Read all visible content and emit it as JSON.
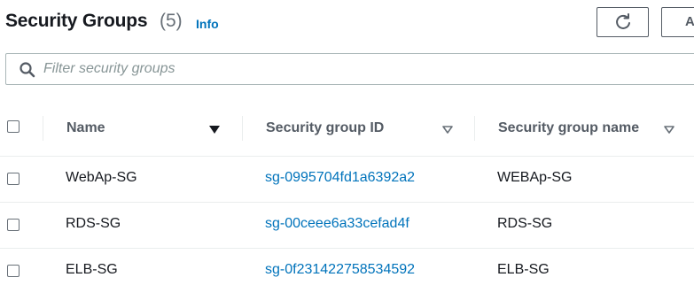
{
  "header": {
    "title": "Security Groups",
    "count": "(5)",
    "info_label": "Info",
    "actions_label": "A"
  },
  "search": {
    "placeholder": "Filter security groups",
    "value": ""
  },
  "table": {
    "columns": [
      {
        "label": "Name",
        "sort": "descending"
      },
      {
        "label": "Security group ID",
        "sort": "none"
      },
      {
        "label": "Security group name",
        "sort": "none"
      }
    ],
    "rows": [
      {
        "name": "WebAp-SG",
        "group_id": "sg-0995704fd1a6392a2",
        "group_name": "WEBAp-SG"
      },
      {
        "name": "RDS-SG",
        "group_id": "sg-00ceee6a33cefad4f",
        "group_name": "RDS-SG"
      },
      {
        "name": "ELB-SG",
        "group_id": "sg-0f231422758534592",
        "group_name": "ELB-SG"
      }
    ]
  },
  "colors": {
    "link": "#0073bb",
    "text": "#16191f",
    "muted": "#687078",
    "border": "#eaeded"
  },
  "icons": {
    "refresh": "refresh-icon",
    "search": "search-icon",
    "sort_active": "caret-down-filled-icon",
    "sort_inactive": "caret-down-outline-icon"
  }
}
